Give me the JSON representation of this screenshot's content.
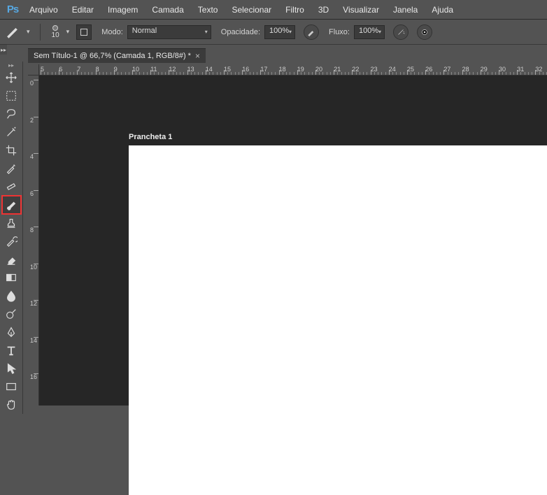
{
  "app": {
    "logo": "Ps"
  },
  "menubar": {
    "items": [
      "Arquivo",
      "Editar",
      "Imagem",
      "Camada",
      "Texto",
      "Selecionar",
      "Filtro",
      "3D",
      "Visualizar",
      "Janela",
      "Ajuda"
    ]
  },
  "optionsbar": {
    "brush_size": "10",
    "mode_label": "Modo:",
    "mode_value": "Normal",
    "opacity_label": "Opacidade:",
    "opacity_value": "100%",
    "flow_label": "Fluxo:",
    "flow_value": "100%"
  },
  "document_tab": {
    "title": "Sem Título-1 @ 66,7% (Camada 1, RGB/8#) *"
  },
  "artboard": {
    "label": "Prancheta 1"
  },
  "ruler_h": [
    "5",
    "6",
    "7",
    "8",
    "9",
    "10",
    "11",
    "12",
    "13",
    "14",
    "15",
    "16",
    "17",
    "18",
    "19",
    "20",
    "21",
    "22",
    "23",
    "24",
    "25",
    "26",
    "27",
    "28",
    "29",
    "30",
    "31",
    "32"
  ],
  "ruler_v": [
    "0",
    "2",
    "4",
    "6",
    "8",
    "10",
    "12",
    "14",
    "16"
  ],
  "tools": [
    {
      "name": "move-tool"
    },
    {
      "name": "marquee-tool"
    },
    {
      "name": "lasso-tool"
    },
    {
      "name": "wand-tool"
    },
    {
      "name": "crop-tool"
    },
    {
      "name": "eyedropper-tool"
    },
    {
      "name": "healing-tool"
    },
    {
      "name": "brush-tool"
    },
    {
      "name": "stamp-tool"
    },
    {
      "name": "history-brush-tool"
    },
    {
      "name": "eraser-tool"
    },
    {
      "name": "gradient-tool"
    },
    {
      "name": "blur-tool"
    },
    {
      "name": "dodge-tool"
    },
    {
      "name": "pen-tool"
    },
    {
      "name": "type-tool"
    },
    {
      "name": "path-select-tool"
    },
    {
      "name": "rectangle-tool"
    },
    {
      "name": "hand-tool"
    }
  ]
}
